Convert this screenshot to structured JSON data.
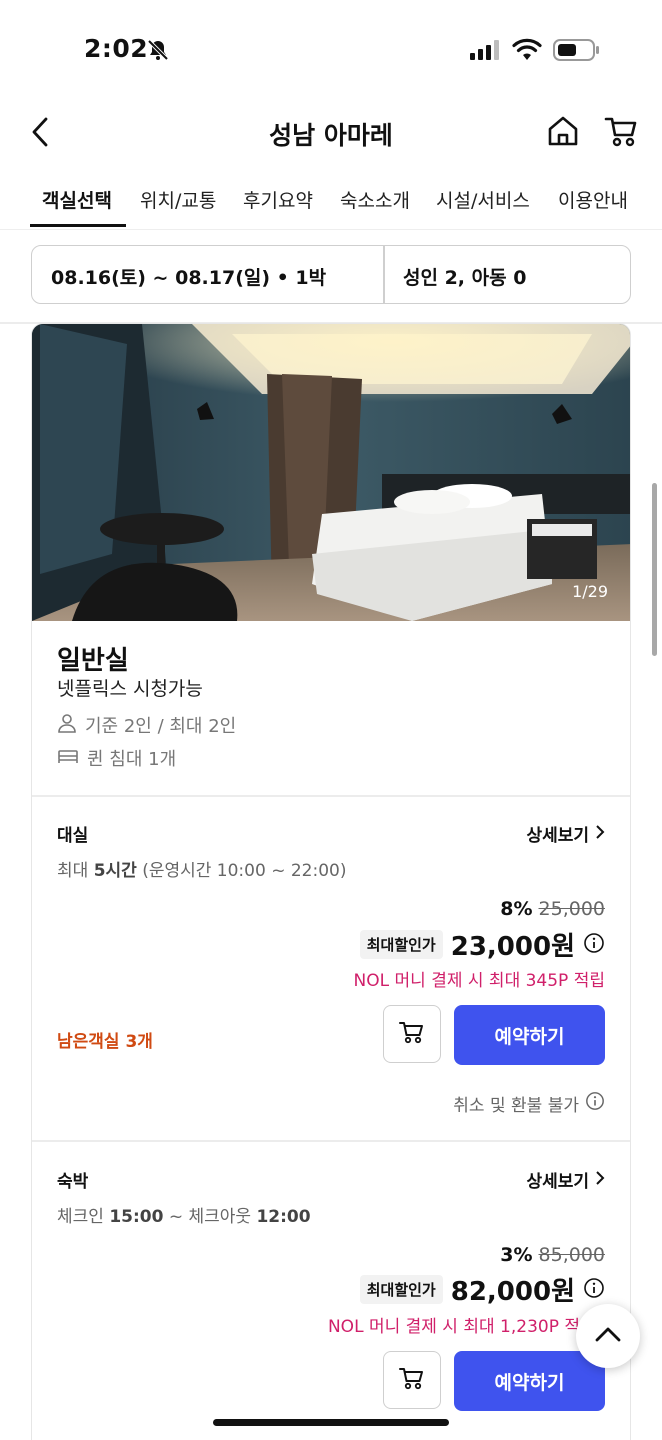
{
  "status_bar": {
    "time": "2:02",
    "icons": [
      "bell-slash-icon",
      "signal-icon",
      "wifi-icon",
      "battery-icon"
    ]
  },
  "header": {
    "title": "성남 아마레",
    "icons": [
      "back-arrow-icon",
      "home-icon",
      "cart-icon"
    ]
  },
  "tabs": [
    {
      "label": "객실선택",
      "active": true
    },
    {
      "label": "위치/교통",
      "active": false
    },
    {
      "label": "후기요약",
      "active": false
    },
    {
      "label": "숙소소개",
      "active": false
    },
    {
      "label": "시설/서비스",
      "active": false
    },
    {
      "label": "이용안내",
      "active": false
    }
  ],
  "search": {
    "dates": "08.16(토) ~ 08.17(일) • 1박",
    "guests": "성인 2, 아동 0"
  },
  "room": {
    "photo_counter": "1/29",
    "name": "일반실",
    "description": "넷플릭스 시청가능",
    "capacity": "기준 2인 / 최대 2인",
    "bed": "퀸 침대 1개"
  },
  "rates": [
    {
      "type": "대실",
      "detail_label": "상세보기",
      "time_prefix": "최대 ",
      "time_bold": "5시간",
      "time_suffix": " (운영시간 10:00 ~ 22:00)",
      "discount": "8%",
      "original_price": "25,000",
      "badge": "최대할인가",
      "price": "23,000원",
      "points": "NOL 머니 결제 시 최대 345P 적립",
      "rooms_left": "남은객실 3개",
      "book_label": "예약하기",
      "refund_note": "취소 및 환불 불가"
    },
    {
      "type": "숙박",
      "detail_label": "상세보기",
      "checkin_label": "체크인 ",
      "checkin_time": "15:00",
      "checkout_label": " ~ 체크아웃 ",
      "checkout_time": "12:00",
      "discount": "3%",
      "original_price": "85,000",
      "badge": "최대할인가",
      "price": "82,000원",
      "points": "NOL 머니 결제 시 최대 1,230P 적",
      "book_label": "예약하기"
    }
  ],
  "colors": {
    "accent_blue": "#3f53ee",
    "points_pink": "#d0206a",
    "rooms_left_orange": "#d04a12"
  }
}
